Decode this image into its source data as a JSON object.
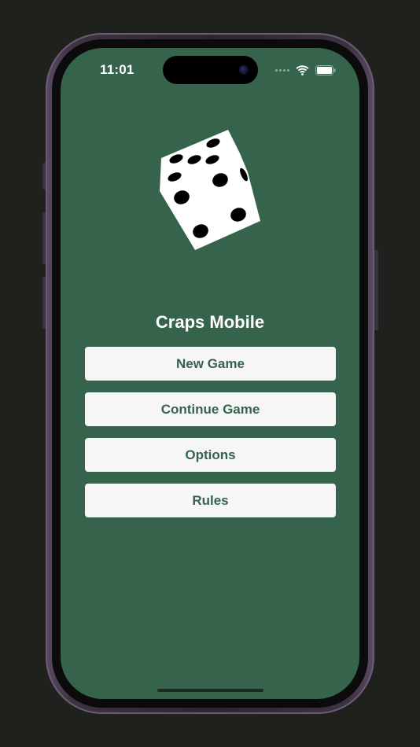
{
  "status_bar": {
    "time": "11:01",
    "icons": [
      "signal-dots-icon",
      "wifi-icon",
      "battery-icon"
    ]
  },
  "app": {
    "title": "Craps Mobile",
    "logo_icon": "dice-icon"
  },
  "menu": {
    "new_game_label": "New Game",
    "continue_game_label": "Continue Game",
    "options_label": "Options",
    "rules_label": "Rules"
  },
  "colors": {
    "background": "#36634b",
    "button_background": "#f6f6f6",
    "button_text": "#36634b",
    "title_text": "#ffffff"
  }
}
